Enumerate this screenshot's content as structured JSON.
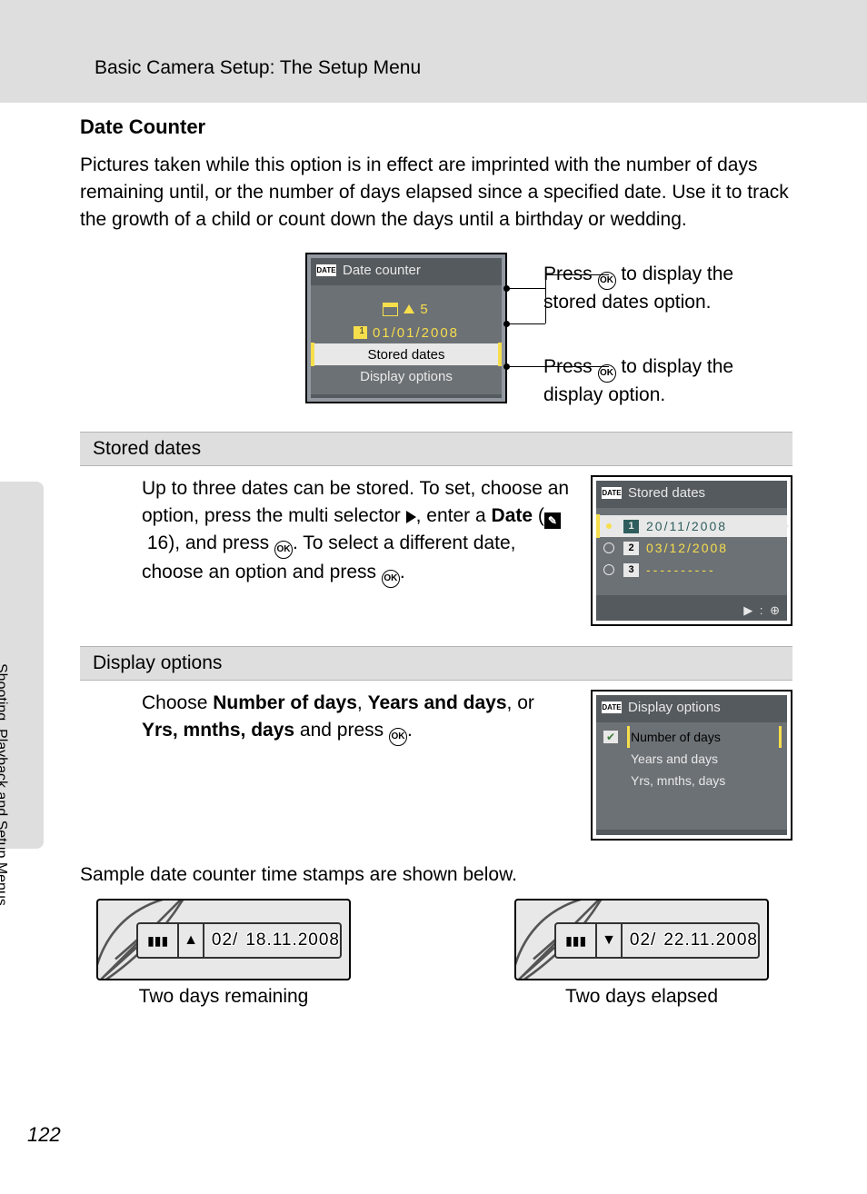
{
  "header": {
    "breadcrumb": "Basic Camera Setup: The Setup Menu"
  },
  "title": "Date Counter",
  "intro": "Pictures taken while this option is in effect are imprinted with the number of days remaining until, or the number of days elapsed since a specified date. Use it to track the growth of a child or count down the days until a birthday or wedding.",
  "main_lcd": {
    "title": "Date counter",
    "counter_value": "5",
    "date_value": "01/01/2008",
    "row_selected": "Stored dates",
    "row_last": "Display options"
  },
  "callouts": {
    "stored_pre": "Press ",
    "stored_post": " to display the stored dates option.",
    "display_pre": "Press ",
    "display_post": " to display the display option."
  },
  "stored": {
    "heading": "Stored dates",
    "text_1": "Up to three dates can be stored. To set, choose an option, press the multi selector ",
    "text_2": ", enter a ",
    "text_bold": "Date",
    "text_3": " (",
    "ref_page": "16",
    "text_4": "), and press ",
    "text_5": ". To select a different date, choose an option and press ",
    "text_6": ".",
    "lcd_title": "Stored dates",
    "dates": [
      "20/11/2008",
      "03/12/2008",
      "----------"
    ],
    "hint": "▶ : ⊕"
  },
  "display": {
    "heading": "Display options",
    "text_1": "Choose ",
    "opts_bold": [
      "Number of days",
      "Years and days",
      "Yrs, mnths, days"
    ],
    "sep_1": ", ",
    "sep_2": ", or ",
    "text_2": " and press ",
    "text_3": ".",
    "lcd_title": "Display options",
    "options": [
      "Number of days",
      "Years and days",
      "Yrs, mnths, days"
    ]
  },
  "samples": {
    "caption": "Sample date counter time stamps are shown below.",
    "left": {
      "count": "02/",
      "date": "18.11.2008",
      "label": "Two days remaining",
      "tri": "▲"
    },
    "right": {
      "count": "02/",
      "date": "22.11.2008",
      "label": "Two days elapsed",
      "tri": "▼"
    }
  },
  "side_tab": "Shooting, Playback and Setup Menus",
  "page_number": "122",
  "glyphs": {
    "ok": "OK",
    "date_badge": "DATE",
    "ref_icon": "✎"
  }
}
